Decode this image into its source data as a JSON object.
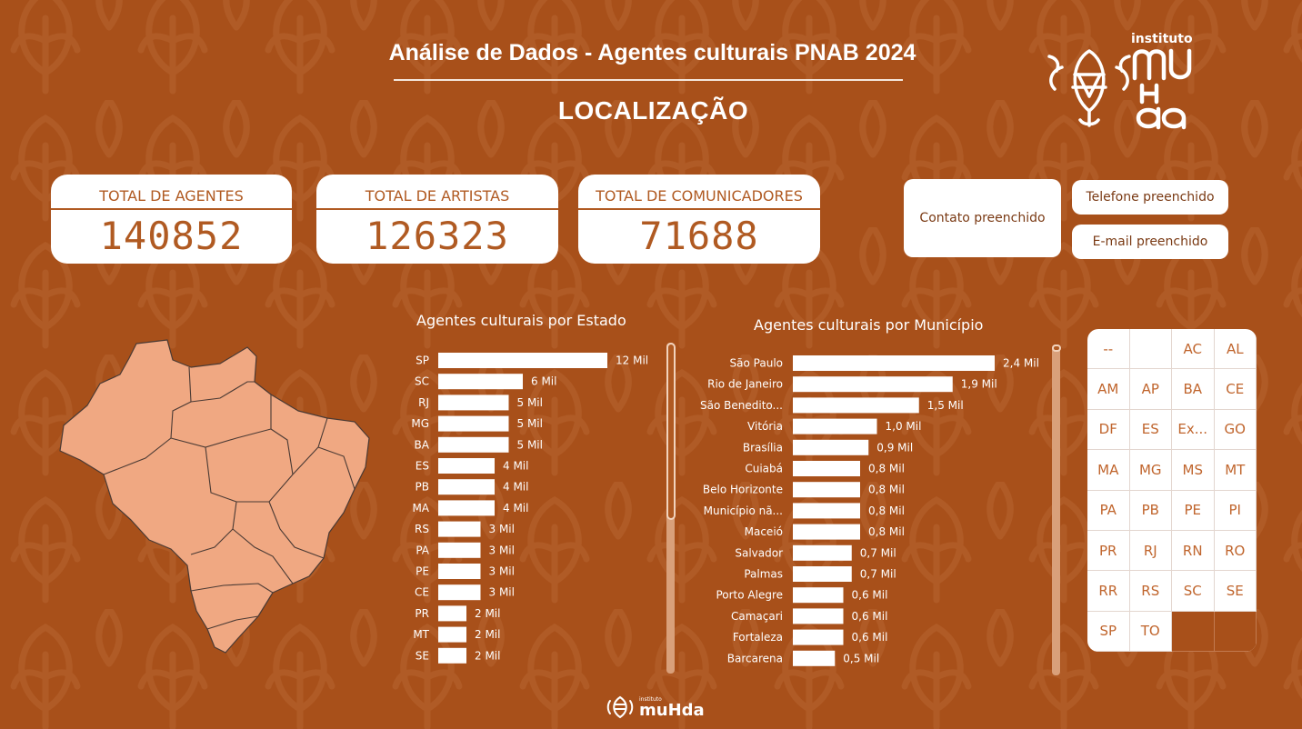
{
  "header": {
    "title": "Análise de Dados - Agentes culturais PNAB 2024",
    "subtitle": "LOCALIZAÇÃO"
  },
  "logo": {
    "small_text": "instituto",
    "brand": "muHda"
  },
  "colors": {
    "background": "#a8501a",
    "accent": "#b05a22",
    "bar": "#ffffff",
    "map_fill": "#f0a882"
  },
  "kpis": [
    {
      "label": "TOTAL DE AGENTES",
      "value": "140852"
    },
    {
      "label": "TOTAL DE ARTISTAS",
      "value": "126323"
    },
    {
      "label": "TOTAL DE COMUNICADORES",
      "value": "71688"
    }
  ],
  "filters": {
    "contato": "Contato preenchido",
    "telefone": "Telefone preenchido",
    "email": "E-mail preenchido"
  },
  "chart_data": [
    {
      "type": "bar",
      "title": "Agentes culturais por Estado",
      "orientation": "horizontal",
      "categories": [
        "SP",
        "SC",
        "RJ",
        "MG",
        "BA",
        "ES",
        "PB",
        "MA",
        "RS",
        "PA",
        "PE",
        "CE",
        "PR",
        "MT",
        "SE"
      ],
      "values": [
        12000,
        6000,
        5000,
        5000,
        5000,
        4000,
        4000,
        4000,
        3000,
        3000,
        3000,
        3000,
        2000,
        2000,
        2000
      ],
      "labels": [
        "12 Mil",
        "6 Mil",
        "5 Mil",
        "5 Mil",
        "5 Mil",
        "4 Mil",
        "4 Mil",
        "4 Mil",
        "3 Mil",
        "3 Mil",
        "3 Mil",
        "3 Mil",
        "2 Mil",
        "2 Mil",
        "2 Mil"
      ]
    },
    {
      "type": "bar",
      "title": "Agentes culturais por Município",
      "orientation": "horizontal",
      "categories": [
        "São Paulo",
        "Rio de Janeiro",
        "São Benedito...",
        "Vitória",
        "Brasília",
        "Cuiabá",
        "Belo Horizonte",
        "Município nã...",
        "Maceió",
        "Salvador",
        "Palmas",
        "Porto Alegre",
        "Camaçari",
        "Fortaleza",
        "Barcarena"
      ],
      "values": [
        2400,
        1900,
        1500,
        1000,
        900,
        800,
        800,
        800,
        800,
        700,
        700,
        600,
        600,
        600,
        500
      ],
      "labels": [
        "2,4 Mil",
        "1,9 Mil",
        "1,5 Mil",
        "1,0 Mil",
        "0,9 Mil",
        "0,8 Mil",
        "0,8 Mil",
        "0,8 Mil",
        "0,8 Mil",
        "0,7 Mil",
        "0,7 Mil",
        "0,6 Mil",
        "0,6 Mil",
        "0,6 Mil",
        "0,5 Mil"
      ]
    }
  ],
  "state_filter": {
    "items": [
      "--",
      "",
      "AC",
      "AL",
      "AM",
      "AP",
      "BA",
      "CE",
      "DF",
      "ES",
      "Ex...",
      "GO",
      "MA",
      "MG",
      "MS",
      "MT",
      "PA",
      "PB",
      "PE",
      "PI",
      "PR",
      "RJ",
      "RN",
      "RO",
      "RR",
      "RS",
      "SC",
      "SE",
      "SP",
      "TO",
      "",
      ""
    ]
  }
}
